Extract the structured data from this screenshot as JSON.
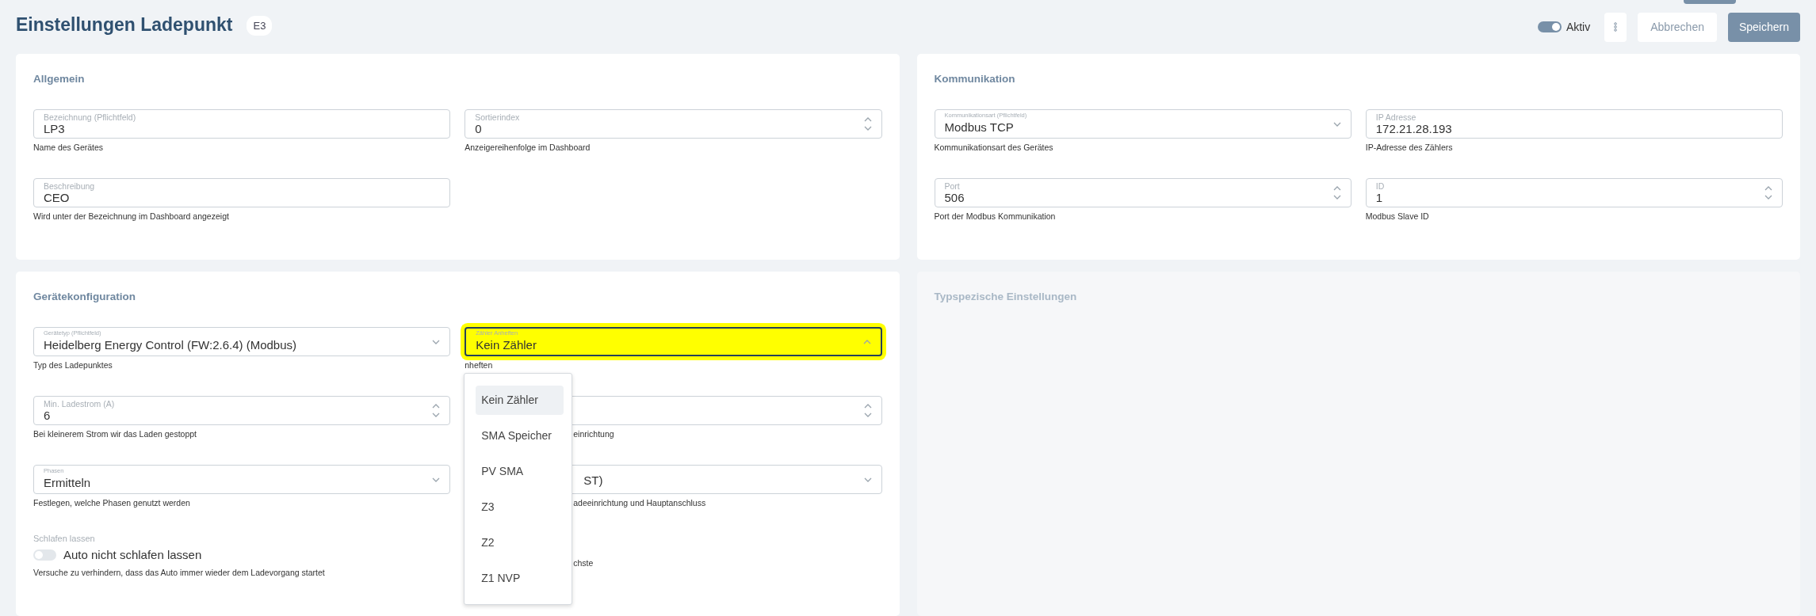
{
  "header": {
    "title": "Einstellungen Ladepunkt",
    "badge": "E3",
    "active": {
      "label": "Aktiv",
      "on": true
    },
    "buttons": [
      {
        "kind": "more"
      },
      {
        "kind": "secondary",
        "label": "Abbrechen"
      },
      {
        "kind": "primary",
        "label": "Speichern"
      }
    ]
  },
  "cards": [
    {
      "title": "Allgemein",
      "disabled": false,
      "columns": [
        [
          {
            "kind": "text",
            "label": "Bezeichnung (Pflichtfeld)",
            "value": "LP3",
            "helper": "Name des Gerätes"
          },
          {
            "kind": "text",
            "label": "Beschreibung",
            "value": "CEO",
            "helper": "Wird unter der Bezeichnung im Dashboard angezeigt"
          }
        ],
        [
          {
            "kind": "number",
            "label": "Sortierindex",
            "value": "0",
            "helper": "Anzeigereihenfolge im Dashboard"
          }
        ]
      ]
    },
    {
      "title": "Kommunikation",
      "disabled": false,
      "columns": [
        [
          {
            "kind": "select",
            "label": "Kommunikationsart (Pflichtfeld)",
            "value": "Modbus TCP",
            "helper": "Kommunikationsart des Gerätes"
          },
          {
            "kind": "number",
            "label": "Port",
            "value": "506",
            "helper": "Port der Modbus Kommunikation"
          }
        ],
        [
          {
            "kind": "text",
            "label": "IP Adresse",
            "value": "172.21.28.193",
            "helper": "IP-Adresse des Zählers"
          },
          {
            "kind": "number",
            "label": "ID",
            "value": "1",
            "helper": "Modbus Slave ID"
          }
        ]
      ]
    },
    {
      "title": "Gerätekonfiguration",
      "disabled": false,
      "columns": [
        [
          {
            "kind": "select",
            "label": "Gerätetyp (Pflichtfeld)",
            "value": "Heidelberg Energy Control (FW:2.6.4) (Modbus)",
            "helper": "Typ des Ladepunktes"
          },
          {
            "kind": "number",
            "label": "Min. Ladestrom (A)",
            "value": "6",
            "helper": "Bei kleinerem Strom wir das Laden gestoppt"
          },
          {
            "kind": "select",
            "label": "Phasen",
            "value": "Ermitteln",
            "helper": "Festlegen, welche Phasen genutzt werden"
          },
          {
            "kind": "toggle",
            "label": "Schlafen lassen",
            "text": "Auto nicht schlafen lassen",
            "on": false,
            "helper": "Versuche zu verhindern, dass das Auto immer wieder dem Ladevorgang startet"
          }
        ],
        [
          {
            "kind": "select",
            "label": "Zähler Anheften",
            "value": "Kein Zähler",
            "helper": "nheften",
            "highlighted": true,
            "open": true,
            "options": [
              {
                "label": "Kein Zähler",
                "selected": true
              },
              {
                "label": "SMA Speicher",
                "selected": false
              },
              {
                "label": "PV SMA",
                "selected": false
              },
              {
                "label": "Z3",
                "selected": false
              },
              {
                "label": "Z2",
                "selected": false
              },
              {
                "label": "Z1 NVP",
                "selected": false
              }
            ]
          },
          {
            "kind": "number",
            "helper": "einrichtung"
          },
          {
            "kind": "select",
            "value": "ST)",
            "helper": "adeeinrichtung und Hauptanschluss"
          },
          {
            "kind": "note",
            "helper": "chste"
          }
        ]
      ]
    },
    {
      "title": "Typspezische Einstellungen",
      "disabled": true
    }
  ]
}
